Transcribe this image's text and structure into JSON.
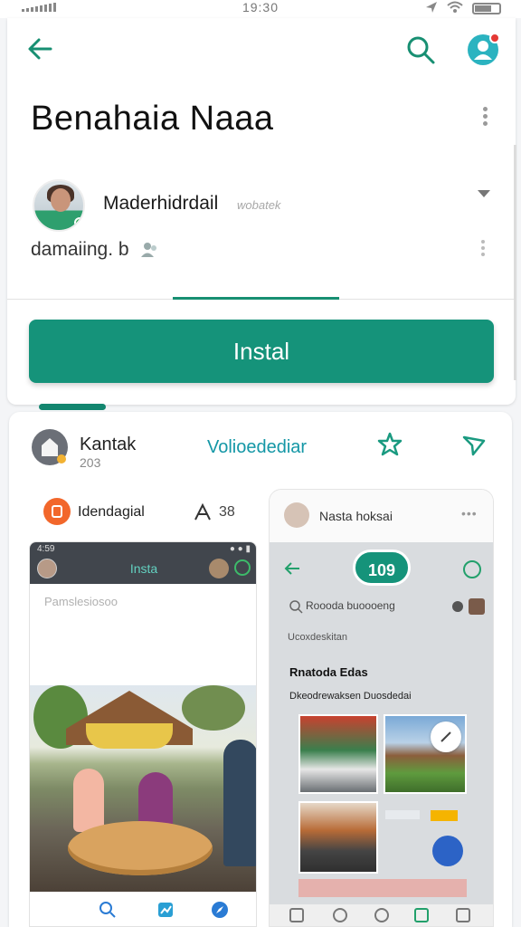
{
  "status_bar": {
    "time": "19:30"
  },
  "header": {
    "title": "Benahaia Naaa"
  },
  "profile": {
    "name": "Maderhidrdail",
    "tag": "wobatek",
    "subtitle": "damaiing. b"
  },
  "actions": {
    "install_label": "Instal"
  },
  "post": {
    "author": "Kantak",
    "author_sub": "203",
    "link_label": "Volioedediar"
  },
  "app_row": {
    "name": "Idendagial",
    "count": "38"
  },
  "left_screen": {
    "time": "4:59",
    "title": "Insta",
    "placeholder": "Pamslesiosoo"
  },
  "right_screen": {
    "name": "Nasta hoksai",
    "pill": "109",
    "search_text": "Roooda buoooeng",
    "section": "Ucoxdeskitan",
    "heading": "Rnatoda Edas",
    "line": "Dkeodrewaksen Duosdedai"
  },
  "colors": {
    "accent": "#15937a",
    "link": "#1497a6",
    "badge_red": "#e53935",
    "app_icon": "#f2672b"
  }
}
